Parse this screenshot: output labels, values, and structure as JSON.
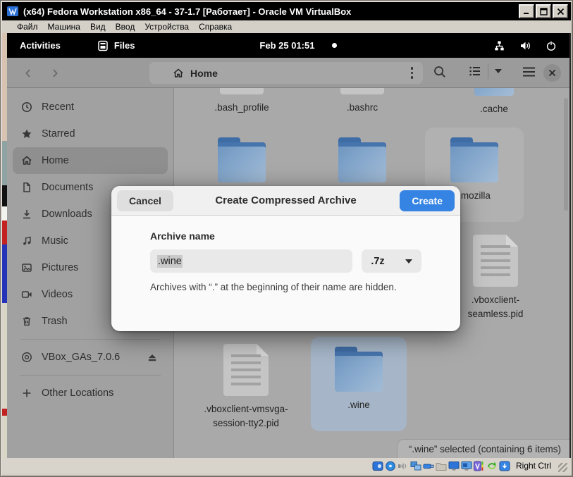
{
  "window": {
    "title": "(x64) Fedora Workstation x86_64 - 37-1.7 [Работает] - Oracle VM VirtualBox",
    "menu": [
      {
        "label": "Файл"
      },
      {
        "label": "Машина"
      },
      {
        "label": "Вид"
      },
      {
        "label": "Ввод"
      },
      {
        "label": "Устройства"
      },
      {
        "label": "Справка"
      }
    ],
    "host_key": "Right Ctrl",
    "status_icons": [
      "hard-disk",
      "optical-disc",
      "audio",
      "network",
      "usb",
      "shared-folder",
      "display",
      "recording",
      "features",
      "mouse-integration",
      "keyboard"
    ]
  },
  "topbar": {
    "activities_label": "Activities",
    "app_label": "Files",
    "clock": "Feb 25 01:51",
    "tray_icons": [
      "wired-network",
      "volume",
      "power"
    ]
  },
  "toolbar": {
    "location": "Home",
    "icons": [
      "back-chevron",
      "forward-chevron",
      "home",
      "kebab-menu",
      "search",
      "list-view",
      "chevron-down",
      "hamburger-menu",
      "close"
    ]
  },
  "sidebar": {
    "items": [
      {
        "label": "Recent",
        "icon": "recent-icon"
      },
      {
        "label": "Starred",
        "icon": "star-icon"
      },
      {
        "label": "Home",
        "icon": "home-icon",
        "selected": true
      },
      {
        "label": "Documents",
        "icon": "document-icon"
      },
      {
        "label": "Downloads",
        "icon": "download-icon"
      },
      {
        "label": "Music",
        "icon": "music-icon"
      },
      {
        "label": "Pictures",
        "icon": "picture-icon"
      },
      {
        "label": "Videos",
        "icon": "video-icon"
      },
      {
        "label": "Trash",
        "icon": "trash-icon"
      }
    ],
    "device": {
      "label": "VBox_GAs_7.0.6",
      "icon": "disc-icon",
      "action_icon": "eject-icon"
    },
    "other_locations": {
      "label": "Other Locations",
      "icon": "plus-icon"
    }
  },
  "files": {
    "items": [
      {
        "name": ".bash_profile",
        "type": "document"
      },
      {
        "name": ".bashrc",
        "type": "document"
      },
      {
        "name": ".cache",
        "type": "folder"
      },
      {
        "type": "folder"
      },
      {
        "type": "folder"
      },
      {
        "name": ".mozilla",
        "type": "folder"
      },
      {
        "name": ".vboxclient-seamless.pid",
        "type": "document"
      },
      {
        "name": ".vboxclient-vmsvga-session-tty2.pid",
        "type": "document"
      },
      {
        "name": ".wine",
        "type": "folder",
        "selected": true
      }
    ],
    "selection_status": "“.wine” selected  (containing 6 items)"
  },
  "dialog": {
    "title": "Create Compressed Archive",
    "cancel_label": "Cancel",
    "create_label": "Create",
    "field_label": "Archive name",
    "name_value": ".wine",
    "format_value": ".7z",
    "hint": "Archives with “.” at the beginning of their name are hidden."
  },
  "colors": {
    "accent": "#3584e4",
    "selection_tint": "#a6b6c8",
    "shell_bar": "#000000",
    "frame": "#d4d0c8"
  }
}
